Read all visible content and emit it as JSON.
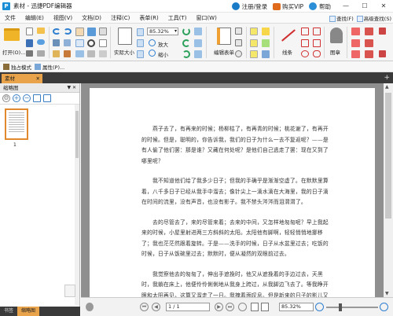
{
  "titlebar": {
    "app_icon": "P",
    "title": "素材 - 迅捷PDF编辑器",
    "login": "注册/登录",
    "vip": "购买VIP",
    "help": "帮助",
    "minimize": "—",
    "maximize": "☐",
    "close": "✕"
  },
  "menubar": {
    "items": [
      "文件",
      "编辑(E)",
      "视图(V)",
      "文档(D)",
      "注释(C)",
      "表单(R)",
      "工具(T)",
      "窗口(W)"
    ],
    "find": "查找(F)",
    "advanced_search": "高级查找(S)"
  },
  "ribbon": {
    "open": "打开(O)...",
    "zoom_value": "85.32%",
    "enlarge": "放大",
    "shrink": "缩小",
    "actual_size": "实际大小",
    "edit_form": "编辑表单",
    "line": "线条",
    "stamp": "图章"
  },
  "quickbar": {
    "exclusive_mode": "独占模式",
    "properties": "属性(P)..."
  },
  "tabs": {
    "doc_tab": "素材",
    "close": "✕",
    "add": "+"
  },
  "leftpanel": {
    "header": "缩略图",
    "pin": "▼ ✕",
    "page_number": "1",
    "tab_bookmarks": "书签",
    "tab_thumbnails": "缩略图"
  },
  "document": {
    "paragraphs": [
      "燕子去了，有再来的时候；杨柳枯了，有再青的时候；桃花谢了，有再开的时候。但是，聪明的，你告诉我，我们的日子为什么一去不复返呢？——是有人偷了他们罢：那是谁？又藏在何处呢？是他们自己逃走了罢：现在又到了哪里呢？",
      "我不知道他们给了我多少日子；但我的手确乎是渐渐空虚了。在默默里算着，八千多日子已经从我手中溜去；像针尖上一滴水滴在大海里，我的日子滴在时间的流里，没有声音，也没有影子。我不禁头涔涔而泪潸潸了。",
      "去的尽管去了，来的尽管来着；去来的中间，又怎样地匆匆呢？早上我起来的时候，小屋里射进两三方斜斜的太阳。太阳他有脚啊，轻轻悄悄地挪移了；我也茫茫然跟着旋转。于是——洗手的时候，日子从水盆里过去；吃饭的时候，日子从饭碗里过去；默默时，便从凝然的双眼前过去。",
      "我觉察他去的匆匆了，伸出手遮挽时，他又从遮挽着的手边过去，天黑时，我躺在床上，他便伶伶俐俐地从我身上跨过，从我脚边飞去了。等我睁开眼和太阳再见，这算又溜走了一日。我掩着面叹息。但是新来的日子的影儿又开始在叹息里闪过了。"
    ]
  },
  "statusbar": {
    "page": "1 / 1",
    "zoom": "85.32%",
    "nav_first": "⏮",
    "nav_prev": "◀",
    "nav_next": "▶",
    "nav_last": "⏭"
  },
  "colors": {
    "accent": "#e9a34b",
    "link_blue": "#1a8fd6",
    "dark_bar": "#3a3a3a",
    "doc_bg": "#8f8f8f"
  }
}
